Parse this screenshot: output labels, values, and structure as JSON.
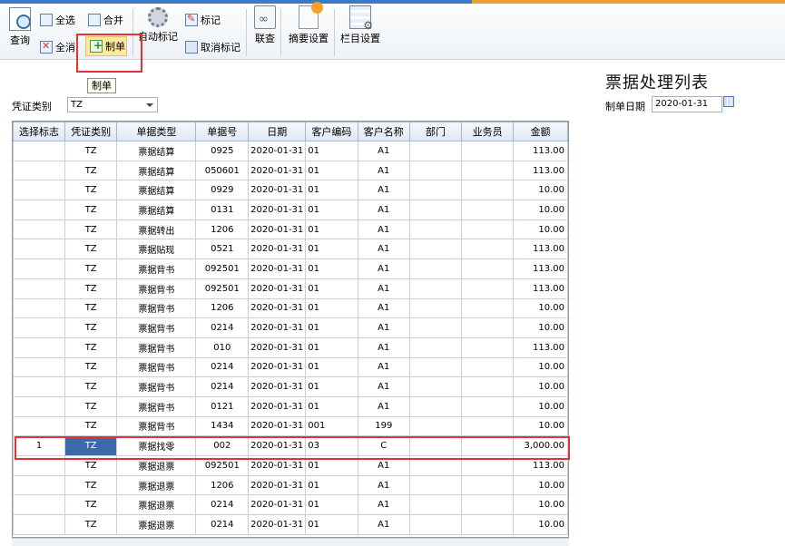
{
  "toolbar": {
    "query": "查询",
    "select_all": "全选",
    "deselect_all": "全消",
    "merge": "合并",
    "make_voucher": "制单",
    "auto_mark": "自动标记",
    "mark": "标记",
    "unmark": "取消标记",
    "link": "联查",
    "summary_settings": "摘要设置",
    "column_settings": "栏目设置"
  },
  "tooltip": "制单",
  "report": {
    "title": "票据处理列表",
    "voucher_type_label": "凭证类别",
    "voucher_type_value": "TZ",
    "date_label": "制单日期",
    "date_value": "2020-01-31"
  },
  "table": {
    "columns": [
      "选择标志",
      "凭证类别",
      "单据类型",
      "单据号",
      "日期",
      "客户编码",
      "客户名称",
      "部门",
      "业务员",
      "金额"
    ],
    "rows": [
      [
        "",
        "TZ",
        "票据结算",
        "0925",
        "2020-01-31",
        "01",
        "A1",
        "",
        "",
        "113.00"
      ],
      [
        "",
        "TZ",
        "票据结算",
        "050601",
        "2020-01-31",
        "01",
        "A1",
        "",
        "",
        "113.00"
      ],
      [
        "",
        "TZ",
        "票据结算",
        "0929",
        "2020-01-31",
        "01",
        "A1",
        "",
        "",
        "10.00"
      ],
      [
        "",
        "TZ",
        "票据结算",
        "0131",
        "2020-01-31",
        "01",
        "A1",
        "",
        "",
        "10.00"
      ],
      [
        "",
        "TZ",
        "票据转出",
        "1206",
        "2020-01-31",
        "01",
        "A1",
        "",
        "",
        "10.00"
      ],
      [
        "",
        "TZ",
        "票据贴现",
        "0521",
        "2020-01-31",
        "01",
        "A1",
        "",
        "",
        "113.00"
      ],
      [
        "",
        "TZ",
        "票据背书",
        "092501",
        "2020-01-31",
        "01",
        "A1",
        "",
        "",
        "113.00"
      ],
      [
        "",
        "TZ",
        "票据背书",
        "092501",
        "2020-01-31",
        "01",
        "A1",
        "",
        "",
        "113.00"
      ],
      [
        "",
        "TZ",
        "票据背书",
        "1206",
        "2020-01-31",
        "01",
        "A1",
        "",
        "",
        "10.00"
      ],
      [
        "",
        "TZ",
        "票据背书",
        "0214",
        "2020-01-31",
        "01",
        "A1",
        "",
        "",
        "10.00"
      ],
      [
        "",
        "TZ",
        "票据背书",
        "010",
        "2020-01-31",
        "01",
        "A1",
        "",
        "",
        "113.00"
      ],
      [
        "",
        "TZ",
        "票据背书",
        "0214",
        "2020-01-31",
        "01",
        "A1",
        "",
        "",
        "10.00"
      ],
      [
        "",
        "TZ",
        "票据背书",
        "0214",
        "2020-01-31",
        "01",
        "A1",
        "",
        "",
        "10.00"
      ],
      [
        "",
        "TZ",
        "票据背书",
        "0121",
        "2020-01-31",
        "01",
        "A1",
        "",
        "",
        "10.00"
      ],
      [
        "",
        "TZ",
        "票据背书",
        "1434",
        "2020-01-31",
        "001",
        "199",
        "",
        "",
        "10.00"
      ],
      [
        "1",
        "TZ",
        "票据找零",
        "002",
        "2020-01-31",
        "03",
        "C",
        "",
        "",
        "3,000.00"
      ],
      [
        "",
        "TZ",
        "票据退票",
        "092501",
        "2020-01-31",
        "01",
        "A1",
        "",
        "",
        "113.00"
      ],
      [
        "",
        "TZ",
        "票据退票",
        "1206",
        "2020-01-31",
        "01",
        "A1",
        "",
        "",
        "10.00"
      ],
      [
        "",
        "TZ",
        "票据退票",
        "0214",
        "2020-01-31",
        "01",
        "A1",
        "",
        "",
        "10.00"
      ],
      [
        "",
        "TZ",
        "票据退票",
        "0214",
        "2020-01-31",
        "01",
        "A1",
        "",
        "",
        "10.00"
      ]
    ],
    "selected_row_index": 15
  },
  "colors": {
    "selected_cell": "#3c6aa8",
    "highlight_box": "#e53333",
    "tooltip_button": "#fde9a2"
  }
}
